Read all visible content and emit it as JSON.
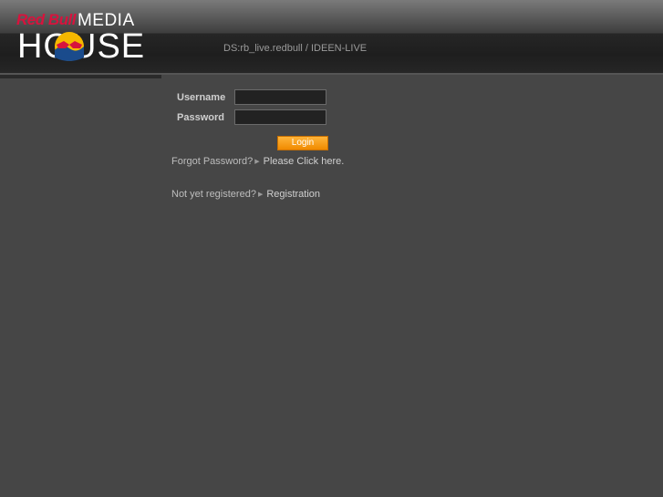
{
  "header": {
    "logo": {
      "brand": "Red Bull",
      "top_word": "MEDIA",
      "bottom_word": "HOUSE"
    },
    "data_source": "DS:rb_live.redbull / IDEEN-LIVE"
  },
  "login": {
    "username_label": "Username",
    "username_value": "",
    "password_label": "Password",
    "password_value": "",
    "login_button": "Login"
  },
  "links": {
    "forgot_text": "Forgot Password?",
    "forgot_link": "Please Click here.",
    "register_text": "Not yet registered?",
    "register_link": "Registration"
  },
  "icons": {
    "link_arrow": "arrow-right-icon"
  },
  "colors": {
    "background": "#464646",
    "brand_red": "#d7133d",
    "button_orange": "#f39a14"
  }
}
